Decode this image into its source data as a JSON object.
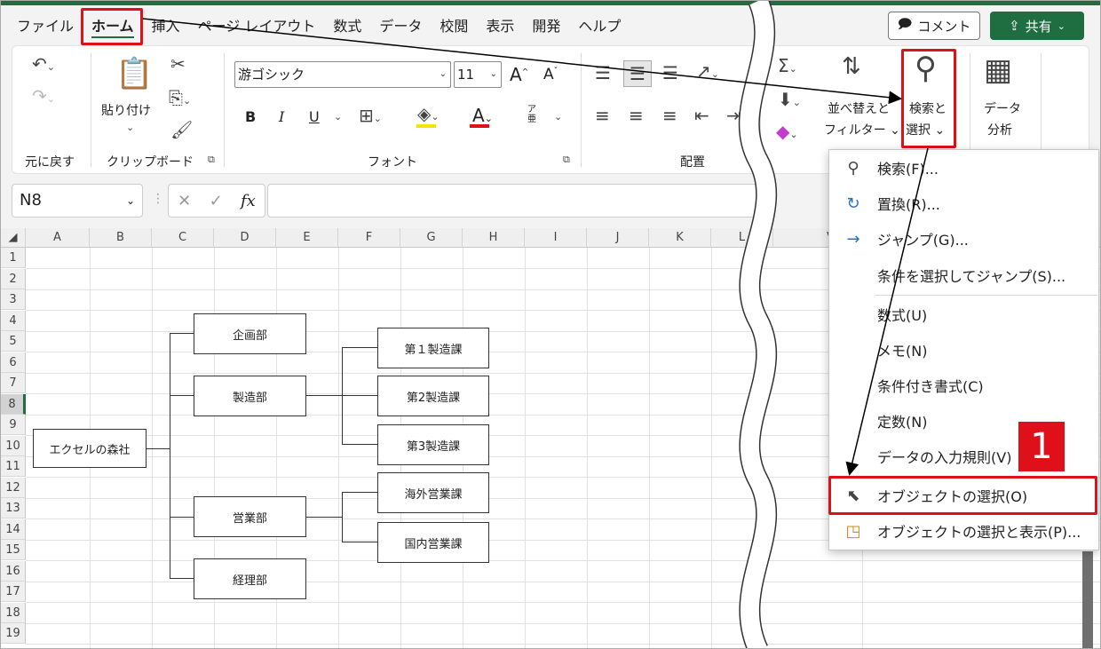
{
  "menu": {
    "tabs": [
      "ファイル",
      "ホーム",
      "挿入",
      "ページ レイアウト",
      "数式",
      "データ",
      "校閲",
      "表示",
      "開発",
      "ヘルプ"
    ],
    "comment_label": "コメント",
    "share_label": "共有"
  },
  "ribbon": {
    "undo_label": "元に戻す",
    "clipboard_label": "クリップボード",
    "paste_label": "貼り付け",
    "font_group_label": "フォント",
    "font_name": "游ゴシック",
    "font_size": "11",
    "bold": "B",
    "italic": "I",
    "underline": "U",
    "phonetic": "ア亜",
    "align_label": "配置",
    "sort_label_1": "並べ替えと",
    "sort_label_2": "フィルター",
    "find_label_1": "検索と",
    "find_label_2": "選択",
    "analyze_label_1": "データ",
    "analyze_label_2": "分析"
  },
  "formula_bar": {
    "name_box": "N8",
    "fx": "fx"
  },
  "grid": {
    "columns": [
      "A",
      "B",
      "C",
      "D",
      "E",
      "F",
      "G",
      "H",
      "I",
      "J",
      "K",
      "L",
      "V"
    ],
    "rows": [
      "1",
      "2",
      "3",
      "4",
      "5",
      "6",
      "7",
      "8",
      "9",
      "10",
      "11",
      "12",
      "13",
      "14",
      "15",
      "16",
      "17",
      "18",
      "19"
    ]
  },
  "org_chart": {
    "root": "エクセルの森社",
    "departments": [
      "企画部",
      "製造部",
      "営業部",
      "経理部"
    ],
    "sections": [
      "第１製造課",
      "第2製造課",
      "第3製造課",
      "海外営業課",
      "国内営業課"
    ]
  },
  "dropdown": {
    "items": [
      "検索(F)...",
      "置換(R)...",
      "ジャンプ(G)...",
      "条件を選択してジャンプ(S)...",
      "数式(U)",
      "メモ(N)",
      "条件付き書式(C)",
      "定数(N)",
      "データの入力規則(V)",
      "オブジェクトの選択(O)",
      "オブジェクトの選択と表示(P)..."
    ]
  },
  "annotation": {
    "step": "1"
  },
  "colors": {
    "accent": "#1e6e42",
    "highlight": "#e0101a"
  }
}
